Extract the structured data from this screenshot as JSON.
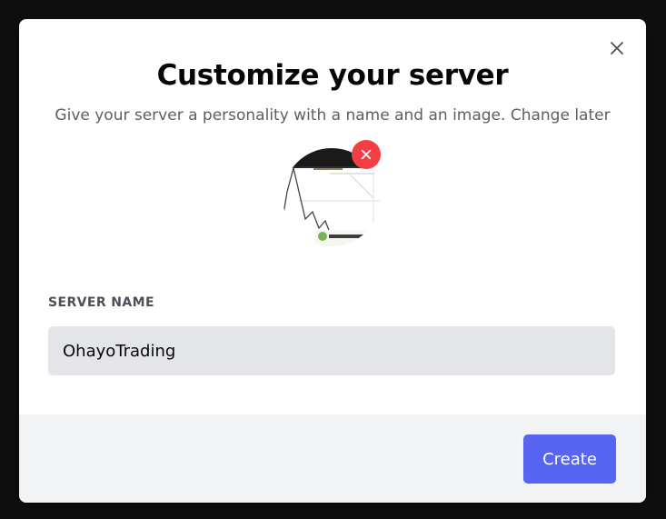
{
  "modal": {
    "title": "Customize your server",
    "subtitle": "Give your server a personality with a name and an image. Change later"
  },
  "avatar": {
    "image_icon": "server-image-thumbnail",
    "remove_icon": "close-icon"
  },
  "form": {
    "server_name_label": "SERVER NAME",
    "server_name_value": "OhayoTrading"
  },
  "footer": {
    "create_label": "Create"
  },
  "colors": {
    "accent": "#5865f2",
    "danger": "#f23f43",
    "input_bg": "#e3e5e8",
    "footer_bg": "#f2f3f5"
  }
}
